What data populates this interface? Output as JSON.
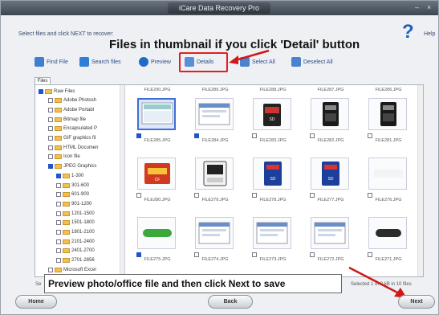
{
  "window": {
    "title": "iCare Data Recovery Pro",
    "minimize": "–",
    "close": "×"
  },
  "instruction": "Select files and click NEXT to recover:",
  "help_label": "Help",
  "help_icon": "question-icon",
  "headline": "Files in thumbnail if you click 'Detail' button",
  "toolbar": {
    "find_file": "Find File",
    "search_files": "Search files",
    "preview": "Preview",
    "details": "Details",
    "select_all": "Select All",
    "deselect_all": "Deselect All"
  },
  "files_tab": "Files",
  "tree": [
    {
      "label": "Raw Files",
      "checked": true
    },
    {
      "label": "Adobe Photosh",
      "checked": false
    },
    {
      "label": "Adobe Portabl",
      "checked": false
    },
    {
      "label": "Bitmap file",
      "checked": false
    },
    {
      "label": "Encapsulated P",
      "checked": false
    },
    {
      "label": "GIF graphics fil",
      "checked": false
    },
    {
      "label": "HTML Documen",
      "checked": false
    },
    {
      "label": "Icon file",
      "checked": false
    },
    {
      "label": "JPEG Graphics",
      "checked": true
    },
    {
      "label": "1-300",
      "checked": true
    },
    {
      "label": "301-600",
      "checked": false
    },
    {
      "label": "601-900",
      "checked": false
    },
    {
      "label": "901-1200",
      "checked": false
    },
    {
      "label": "1201-1500",
      "checked": false
    },
    {
      "label": "1501-1800",
      "checked": false
    },
    {
      "label": "1801-2100",
      "checked": false
    },
    {
      "label": "2101-2400",
      "checked": false
    },
    {
      "label": "2401-2700",
      "checked": false
    },
    {
      "label": "2701-2856",
      "checked": false
    },
    {
      "label": "Microsoft Excel",
      "checked": false
    }
  ],
  "top_row_names": [
    "FILE290.JPG",
    "FILE289.JPG",
    "FILE288.JPG",
    "FILE287.JPG",
    "FILE286.JPG"
  ],
  "rows": [
    [
      {
        "name": "FILE285.JPG",
        "checked": true,
        "selected": true,
        "kind": "photo"
      },
      {
        "name": "FILE284.JPG",
        "checked": true,
        "selected": false,
        "kind": "screen"
      },
      {
        "name": "FILE283.JPG",
        "checked": false,
        "selected": false,
        "kind": "sdcard"
      },
      {
        "name": "FILE282.JPG",
        "checked": false,
        "selected": false,
        "kind": "card-dark"
      },
      {
        "name": "FILE281.JPG",
        "checked": false,
        "selected": false,
        "kind": "card-dark"
      }
    ],
    [
      {
        "name": "FILE280.JPG",
        "checked": false,
        "selected": false,
        "kind": "card-red"
      },
      {
        "name": "FILE279.JPG",
        "checked": false,
        "selected": false,
        "kind": "reader"
      },
      {
        "name": "FILE278.JPG",
        "checked": false,
        "selected": false,
        "kind": "card-blue"
      },
      {
        "name": "FILE277.JPG",
        "checked": false,
        "selected": false,
        "kind": "card-blue"
      },
      {
        "name": "FILE276.JPG",
        "checked": false,
        "selected": false,
        "kind": "blank"
      }
    ],
    [
      {
        "name": "FILE275.JPG",
        "checked": true,
        "selected": false,
        "kind": "green-button"
      },
      {
        "name": "FILE274.JPG",
        "checked": false,
        "selected": false,
        "kind": "screen"
      },
      {
        "name": "FILE273.JPG",
        "checked": false,
        "selected": false,
        "kind": "screen"
      },
      {
        "name": "FILE272.JPG",
        "checked": false,
        "selected": false,
        "kind": "screen"
      },
      {
        "name": "FILE271.JPG",
        "checked": false,
        "selected": false,
        "kind": "dark-pill"
      }
    ]
  ],
  "banner": "Preview photo/office file and then click Next to save",
  "status_left": "Se",
  "status_right": "Selected 1 of 2 kB in 10 files",
  "buttons": {
    "home": "Home",
    "back": "Back",
    "next": "Next"
  },
  "colors": {
    "accent": "#3f7fd1",
    "highlight": "#e02020",
    "selection": "#3d6fd6"
  }
}
